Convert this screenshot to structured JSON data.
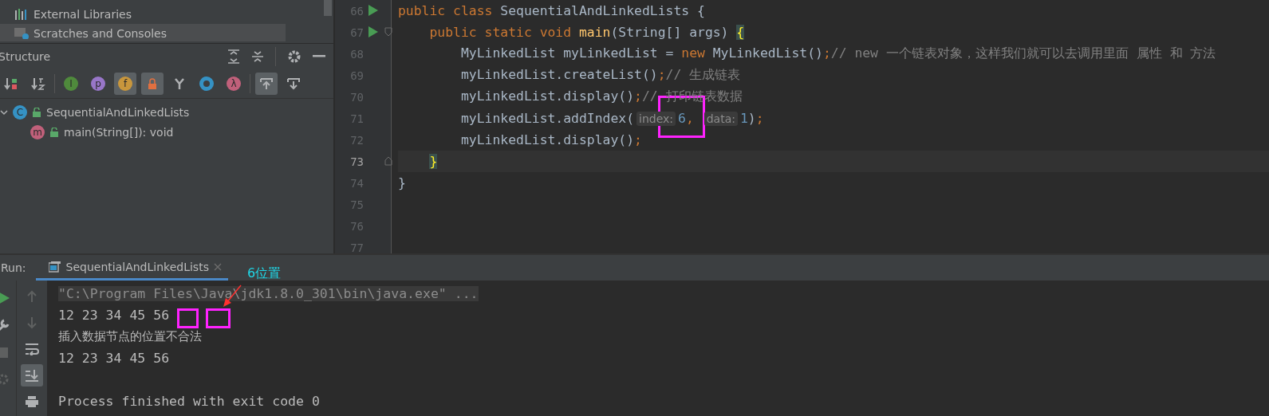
{
  "project_tree": {
    "items": [
      {
        "label": "External Libraries",
        "kind": "libraries",
        "selected": false
      },
      {
        "label": "Scratches and Consoles",
        "kind": "scratches",
        "selected": true
      }
    ]
  },
  "structure": {
    "title": "Structure",
    "toolbar": [
      {
        "kind": "sort-visibility",
        "selected": false
      },
      {
        "kind": "sort-alpha",
        "selected": false
      },
      {
        "kind": "sep"
      },
      {
        "kind": "badge",
        "glyph": "I",
        "color": "#4f8a3c",
        "selected": false
      },
      {
        "kind": "badge",
        "glyph": "p",
        "color": "#9876c8",
        "selected": false
      },
      {
        "kind": "badge",
        "glyph": "f",
        "color": "#c8963c",
        "selected": true
      },
      {
        "kind": "lock",
        "selected": true
      },
      {
        "kind": "fork",
        "selected": false
      },
      {
        "kind": "ring",
        "selected": false
      },
      {
        "kind": "badge",
        "glyph": "λ",
        "color": "#c0607a",
        "selected": false
      },
      {
        "kind": "sep"
      },
      {
        "kind": "scroll-to-source",
        "selected": true
      },
      {
        "kind": "scroll-from-source",
        "selected": false
      }
    ],
    "tree": [
      {
        "label": "SequentialAndLinkedLists",
        "glyph": "C",
        "color": "#3592c4",
        "expanded": true,
        "children": [
          {
            "label": "main(String[]): void",
            "glyph": "m",
            "color": "#c0607a"
          }
        ]
      }
    ]
  },
  "editor": {
    "lines": [
      {
        "number": "66",
        "run": true,
        "kind": "plain",
        "current": false,
        "tokens": [
          {
            "kind": "kw",
            "text": "public class "
          },
          {
            "kind": "plain",
            "text": "SequentialAndLinkedLists {"
          }
        ]
      },
      {
        "number": "67",
        "run": true,
        "kind": "fold-start",
        "current": false,
        "tokens": [
          {
            "kind": "kw",
            "text": "    public static void "
          },
          {
            "kind": "decl",
            "text": "main"
          },
          {
            "kind": "plain",
            "text": "(String[] args) "
          },
          {
            "kind": "brace",
            "text": "{"
          }
        ]
      },
      {
        "number": "68",
        "run": false,
        "kind": "plain",
        "current": false,
        "tokens": [
          {
            "kind": "plain",
            "text": "        MyLinkedList myLinkedList = "
          },
          {
            "kind": "kw",
            "text": "new "
          },
          {
            "kind": "plain",
            "text": "MyLinkedList()"
          },
          {
            "kind": "kw",
            "text": ";"
          },
          {
            "kind": "comment",
            "text": "// new 一个链表对象，这样我们就可以去调用里面 属性 和 方法"
          }
        ]
      },
      {
        "number": "69",
        "run": false,
        "kind": "plain",
        "current": false,
        "tokens": [
          {
            "kind": "plain",
            "text": "        myLinkedList.createList()"
          },
          {
            "kind": "kw",
            "text": ";"
          },
          {
            "kind": "comment",
            "text": "// 生成链表"
          }
        ]
      },
      {
        "number": "70",
        "run": false,
        "kind": "plain",
        "current": false,
        "tokens": [
          {
            "kind": "plain",
            "text": "        myLinkedList.display()"
          },
          {
            "kind": "kw",
            "text": ";"
          },
          {
            "kind": "comment",
            "text": "// 打印链表数据"
          }
        ]
      },
      {
        "number": "71",
        "run": false,
        "kind": "plain",
        "current": false,
        "tokens": [
          {
            "kind": "plain",
            "text": "        myLinkedList.addIndex("
          },
          {
            "kind": "hint",
            "text": "index:"
          },
          {
            "kind": "num",
            "text": "6"
          },
          {
            "kind": "kw",
            "text": ", "
          },
          {
            "kind": "hint",
            "text": "data:"
          },
          {
            "kind": "num",
            "text": "1"
          },
          {
            "kind": "plain",
            "text": ")"
          },
          {
            "kind": "kw",
            "text": ";"
          }
        ]
      },
      {
        "number": "72",
        "run": false,
        "kind": "plain",
        "current": false,
        "tokens": [
          {
            "kind": "plain",
            "text": "        myLinkedList.display()"
          },
          {
            "kind": "kw",
            "text": ";"
          }
        ]
      },
      {
        "number": "73",
        "run": false,
        "kind": "fold-end",
        "current": true,
        "tokens": [
          {
            "kind": "brace",
            "text": "    }"
          }
        ]
      },
      {
        "number": "74",
        "run": false,
        "kind": "plain",
        "current": false,
        "tokens": [
          {
            "kind": "plain",
            "text": "}"
          }
        ]
      },
      {
        "number": "75",
        "run": false,
        "kind": "plain",
        "current": false
      },
      {
        "number": "76",
        "run": false,
        "kind": "plain",
        "current": false
      },
      {
        "number": "77",
        "run": false,
        "kind": "plain",
        "current": false
      }
    ]
  },
  "run_panel": {
    "label": "Run:",
    "tab": {
      "title": "SequentialAndLinkedLists",
      "selected": true
    },
    "left_tools": [
      {
        "kind": "run",
        "disabled": false
      },
      {
        "kind": "wrench",
        "disabled": false
      },
      {
        "kind": "stop",
        "disabled": true
      },
      {
        "kind": "bug",
        "disabled": true
      }
    ],
    "right_tools": [
      {
        "kind": "up",
        "selected": false
      },
      {
        "kind": "down",
        "selected": false
      },
      {
        "kind": "wrap",
        "selected": false
      },
      {
        "kind": "scroll-end",
        "selected": true
      },
      {
        "kind": "print",
        "selected": false
      }
    ],
    "console": [
      {
        "kind": "command",
        "text": "\"C:\\Program Files\\Java\\jdk1.8.0_301\\bin\\java.exe\" ..."
      },
      {
        "kind": "output",
        "text": "12 23 34 45 56"
      },
      {
        "kind": "output",
        "text": "插入数据节点的位置不合法"
      },
      {
        "kind": "output",
        "text": "12 23 34 45 56"
      },
      {
        "kind": "blank"
      },
      {
        "kind": "output",
        "text": "Process finished with exit code 0"
      }
    ]
  },
  "annotations": {
    "label": "6位置"
  }
}
